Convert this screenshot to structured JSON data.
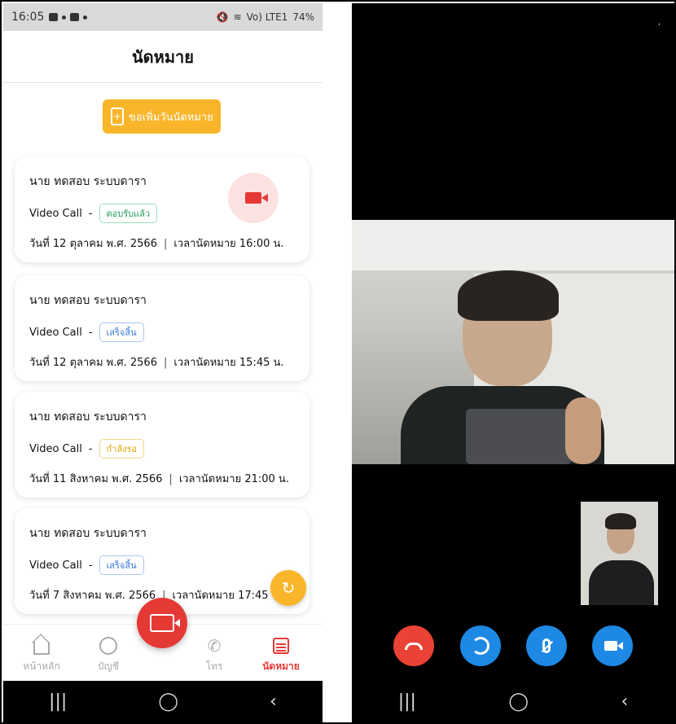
{
  "status_bar": {
    "time": "16:05",
    "battery": "74%",
    "signal_text": "Vo) LTE1"
  },
  "header": {
    "title": "นัดหมาย"
  },
  "add_button": {
    "label": "ขอเพิ่มวันนัดหมาย",
    "icon": "add-file-icon"
  },
  "appointments": [
    {
      "name": "นาย ทดสอบ ระบบดารา",
      "type": "Video Call",
      "dash": "-",
      "status": "ตอบรับแล้ว",
      "status_color": "#1e9e5a",
      "date": "วันที่ 12 ตุลาคม พ.ศ. 2566",
      "time": "เวลานัดหมาย 16:00 น."
    },
    {
      "name": "นาย ทดสอบ ระบบดารา",
      "type": "Video Call",
      "dash": "-",
      "status": "เสร็จสิ้น",
      "status_color": "#3a7bd5",
      "date": "วันที่ 12 ตุลาคม พ.ศ. 2566",
      "time": "เวลานัดหมาย 15:45 น."
    },
    {
      "name": "นาย ทดสอบ ระบบดารา",
      "type": "Video Call",
      "dash": "-",
      "status": "กำลังรอ",
      "status_color": "#e0a400",
      "date": "วันที่ 11 สิงหาคม พ.ศ. 2566",
      "time": "เวลานัดหมาย 21:00 น."
    },
    {
      "name": "นาย ทดสอบ ระบบดารา",
      "type": "Video Call",
      "dash": "-",
      "status": "เสร็จสิ้น",
      "status_color": "#3a7bd5",
      "date": "วันที่ 7 สิงหาคม พ.ศ. 2566",
      "time": "เวลานัดหมาย 17:45 น."
    }
  ],
  "bottom_nav": {
    "home": "หน้าหลัก",
    "account": "บัญชี",
    "call": "โทร",
    "appointments": "นัดหมาย"
  },
  "colors": {
    "accent_yellow": "#f9b62a",
    "accent_red": "#e53935",
    "call_blue": "#1e88e5",
    "hangup_red": "#ea4335"
  }
}
